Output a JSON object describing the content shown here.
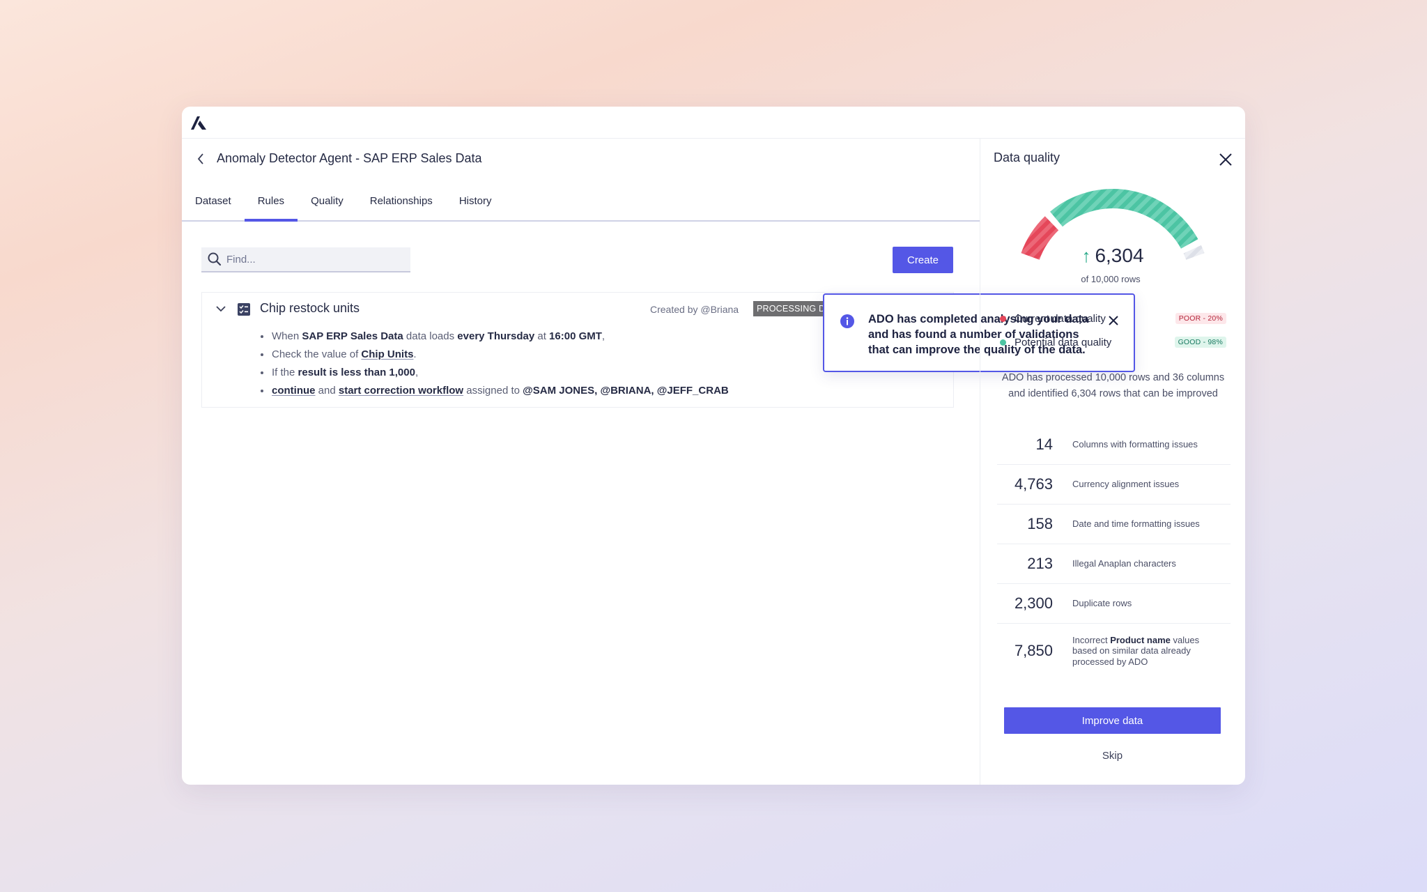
{
  "app": {
    "logo_icon": "anaplan-logo-icon"
  },
  "header": {
    "title": "Anomaly Detector Agent - SAP ERP Sales Data"
  },
  "tabs": [
    {
      "label": "Dataset"
    },
    {
      "label": "Rules",
      "active": true
    },
    {
      "label": "Quality"
    },
    {
      "label": "Relationships"
    },
    {
      "label": "History"
    }
  ],
  "search": {
    "placeholder": "Find..."
  },
  "toolbar": {
    "create_label": "Create"
  },
  "rule": {
    "name": "Chip restock units",
    "created_by": "Created by @Briana",
    "status": "PROCESSING DATA QUALITY",
    "line1": {
      "when": "When",
      "source": "SAP ERP Sales Data",
      "loads": "data loads",
      "schedule": "every Thursday",
      "at": "at",
      "time": "16:00 GMT",
      "end": ","
    },
    "line2": {
      "pre": "Check the value of",
      "field": "Chip Units",
      "end": "."
    },
    "line3": {
      "pre": "If the",
      "condition": "result is less than 1,000",
      "end": ","
    },
    "line4": {
      "action1": "continue",
      "and": "and",
      "action2": "start correction workflow",
      "assigned": "assigned to",
      "assignees": "@SAM JONES, @BRIANA, @JEFF_CRAB"
    }
  },
  "toast": {
    "message": "ADO has completed analysing your data and has found a number of validations that can improve the quality of the data."
  },
  "panel": {
    "title": "Data quality",
    "gauge": {
      "value": "6,304",
      "subtitle": "of 10,000 rows",
      "current_fraction": 0.2,
      "potential_fraction": 0.98
    },
    "legend": [
      {
        "label": "Current data quality",
        "badge": "POOR - 20%",
        "color": "#e5475a",
        "badge_bg": "#fde7ea",
        "badge_fg": "#b32338"
      },
      {
        "label": "Potential data quality",
        "badge": "GOOD - 98%",
        "color": "#4cc4a3",
        "badge_bg": "#dff5ec",
        "badge_fg": "#17795f"
      }
    ],
    "summary": "ADO has processed 10,000 rows and 36 columns and identified 6,304 rows that can be improved",
    "stats": [
      {
        "value": "14",
        "label": "Columns with formatting issues"
      },
      {
        "value": "4,763",
        "label": "Currency alignment issues"
      },
      {
        "value": "158",
        "label": "Date and time formatting issues"
      },
      {
        "value": "213",
        "label": "Illegal Anaplan characters"
      },
      {
        "value": "2,300",
        "label": "Duplicate rows"
      },
      {
        "value": "7,850",
        "label_pre": "Incorrect",
        "label_bold": "Product name",
        "label_post": "values based on similar data already processed by ADO"
      }
    ],
    "improve_label": "Improve data",
    "skip_label": "Skip"
  },
  "colors": {
    "accent": "#5457e6",
    "poor": "#e5475a",
    "good": "#4cc4a3"
  }
}
